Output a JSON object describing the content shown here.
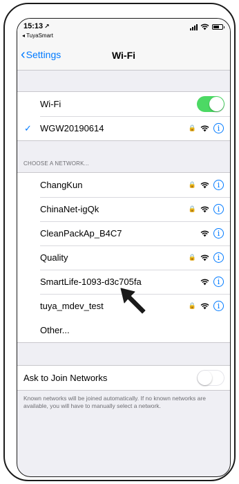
{
  "status_bar": {
    "time": "15:13",
    "location_arrow": "↗",
    "back_app": "◂ TuyaSmart"
  },
  "nav": {
    "back_label": "Settings",
    "title": "Wi-Fi"
  },
  "wifi": {
    "label": "Wi-Fi",
    "enabled": true,
    "connected_network": "WGW20190614"
  },
  "networks_header": "CHOOSE A NETWORK...",
  "networks": [
    {
      "name": "ChangKun",
      "locked": true
    },
    {
      "name": "ChinaNet-igQk",
      "locked": true
    },
    {
      "name": "CleanPackAp_B4C7",
      "locked": false
    },
    {
      "name": "Quality",
      "locked": true
    },
    {
      "name": "SmartLife-1093-d3c705fa",
      "locked": false
    },
    {
      "name": "tuya_mdev_test",
      "locked": true
    }
  ],
  "other_label": "Other...",
  "ask_to_join": {
    "label": "Ask to Join Networks",
    "enabled": false,
    "note": "Known networks will be joined automatically. If no known networks are available, you will have to manually select a network."
  },
  "icons": {
    "lock": "lock-icon",
    "wifi": "wifi-signal-icon",
    "info": "info-icon",
    "cursor": "arrow-cursor-icon"
  },
  "colors": {
    "accent": "#007aff",
    "toggle_on": "#4cd964",
    "background": "#efeff4"
  }
}
